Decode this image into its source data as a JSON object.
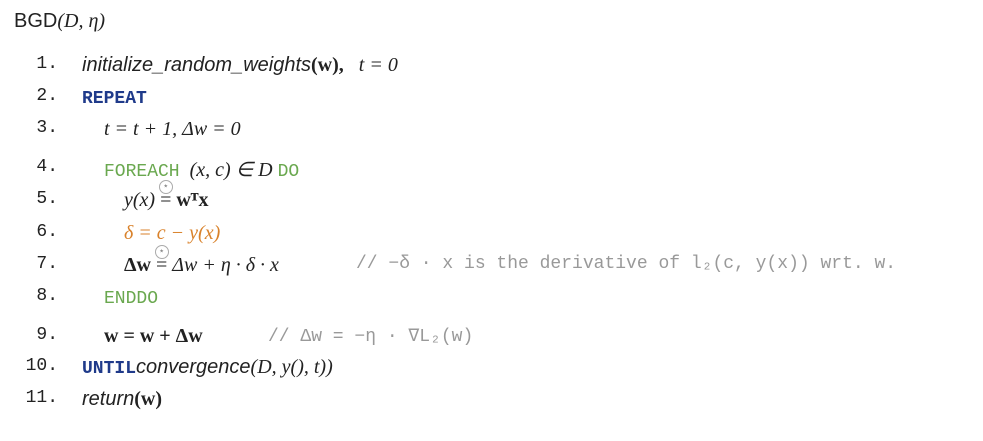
{
  "title": {
    "name": "BGD",
    "args": "(D, η)"
  },
  "lines": [
    {
      "n": "1.",
      "fn": "initialize_random_weights",
      "arg": "(w),",
      "tail": "t = 0"
    },
    {
      "n": "2.",
      "kw": "REPEAT"
    },
    {
      "n": "3.",
      "text": "t = t + 1,  Δw = 0"
    },
    {
      "n": "4.",
      "kw1": "FOREACH",
      "mid": "(x, c) ∈ D",
      "kw2": "DO"
    },
    {
      "n": "5.",
      "lhs": "y(x)",
      "op": "=",
      "star": "⋆",
      "rhs": "wᵀx"
    },
    {
      "n": "6.",
      "text": "δ = c − y(x)"
    },
    {
      "n": "7.",
      "lhs": "Δw",
      "op": "=",
      "star": "⋆",
      "rhs": "Δw + η · δ · x",
      "comment": "// −δ · x is the derivative of l₂(c, y(x)) wrt. w."
    },
    {
      "n": "8.",
      "kw": "ENDDO"
    },
    {
      "n": "9.",
      "text": "w = w + Δw",
      "comment": "// Δw = −η · ∇L₂(w)"
    },
    {
      "n": "10.",
      "kw": "UNTIL",
      "fn": "convergence",
      "args": "(D, y(), t))"
    },
    {
      "n": "11.",
      "fn": "return",
      "args": "(w)"
    }
  ]
}
